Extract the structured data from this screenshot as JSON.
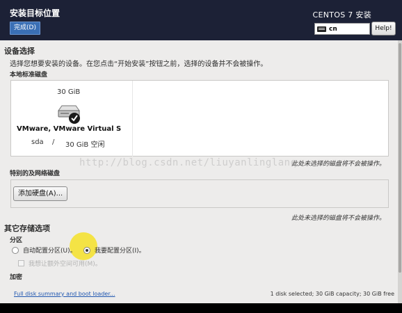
{
  "header": {
    "title": "安装目标位置",
    "done_label": "完成(D)",
    "product": "CENTOS 7 安装",
    "keyboard_layout": "cn",
    "help_label": "Help!"
  },
  "device_selection": {
    "title": "设备选择",
    "description": "选择您想要安装的设备。在您点击“开始安装”按钮之前，选择的设备并不会被操作。",
    "local_disks_label": "本地标准磁盘",
    "disk": {
      "size": "30 GiB",
      "name": "VMware, VMware Virtual S",
      "device": "sda",
      "separator": "/",
      "free": "30 GiB 空闲",
      "selected": true
    },
    "local_note": "此处未选择的磁盘将不会被操作。",
    "special_label": "特别的及网络磁盘",
    "add_disk_label": "添加硬盘(A)...",
    "special_note": "此处未选择的磁盘将不会被操作。"
  },
  "storage_options": {
    "title": "其它存储选项",
    "partitioning_label": "分区",
    "auto_label": "自动配置分区(U)。",
    "manual_label": "我要配置分区(I)。",
    "extra_space_label": "我想让额外空间可用(M)。",
    "encryption_label": "加密"
  },
  "watermark": "http://blog.csdn.net/liuyanlinglanq",
  "footer": {
    "link_label": "Full disk summary and boot loader...",
    "summary": "1 disk selected; 30 GiB capacity; 30 GiB free"
  },
  "colors": {
    "header_bg": "#1c2136",
    "done_button": "#3a6fb5",
    "content_bg": "#edeceb",
    "link": "#1f56b0",
    "highlight": "#f5e12d"
  }
}
